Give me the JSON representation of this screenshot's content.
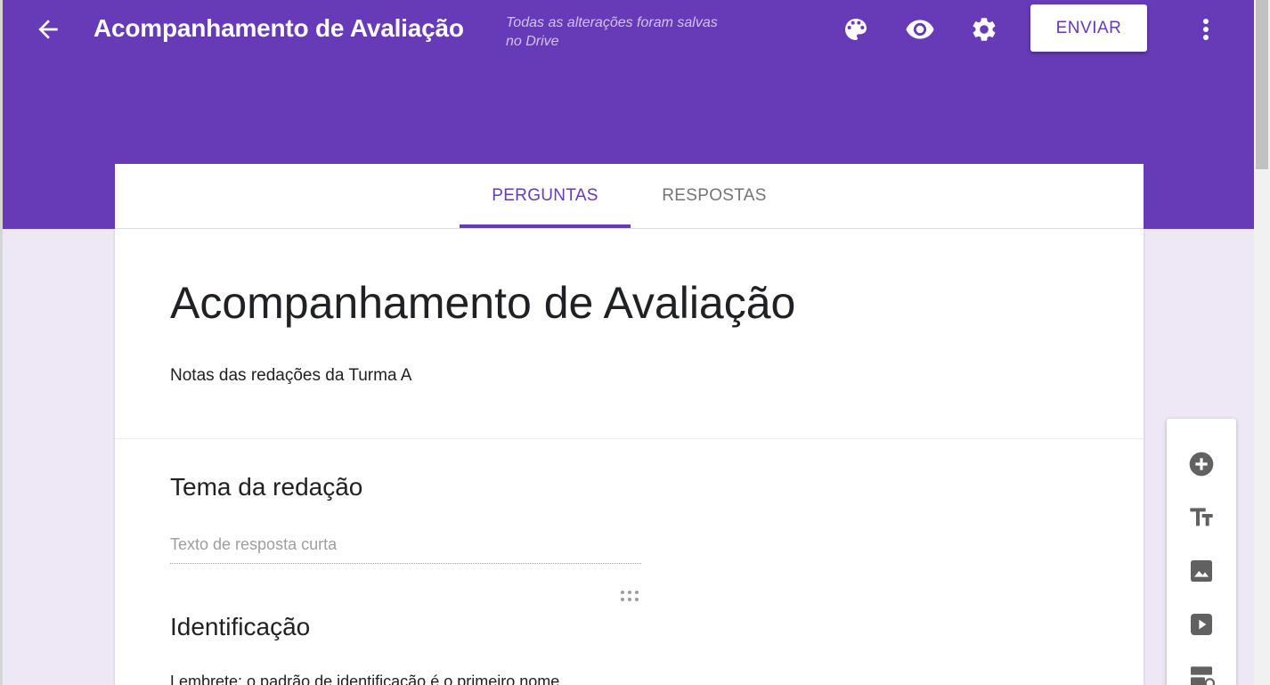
{
  "header": {
    "title": "Acompanhamento de Avaliação",
    "save_status": "Todas as alterações foram salvas no Drive",
    "send_label": "ENVIAR",
    "icons": [
      "arrow-back-icon",
      "palette-icon",
      "eye-icon",
      "gear-icon",
      "more-vert-icon"
    ],
    "brand_color": "#673ab7"
  },
  "tabs": [
    {
      "label": "PERGUNTAS",
      "active": true
    },
    {
      "label": "RESPOSTAS",
      "active": false
    }
  ],
  "form": {
    "title": "Acompanhamento de Avaliação",
    "description": "Notas das redações da Turma A",
    "questions": [
      {
        "title": "Tema da redação",
        "placeholder": "Texto de resposta curta"
      },
      {
        "title": "Identificação",
        "description": "Lembrete: o padrão de identificação é o primeiro nome"
      }
    ]
  },
  "toolbar": {
    "icons": [
      "add-question-icon",
      "add-title-icon",
      "add-image-icon",
      "add-video-icon",
      "add-section-icon"
    ]
  }
}
